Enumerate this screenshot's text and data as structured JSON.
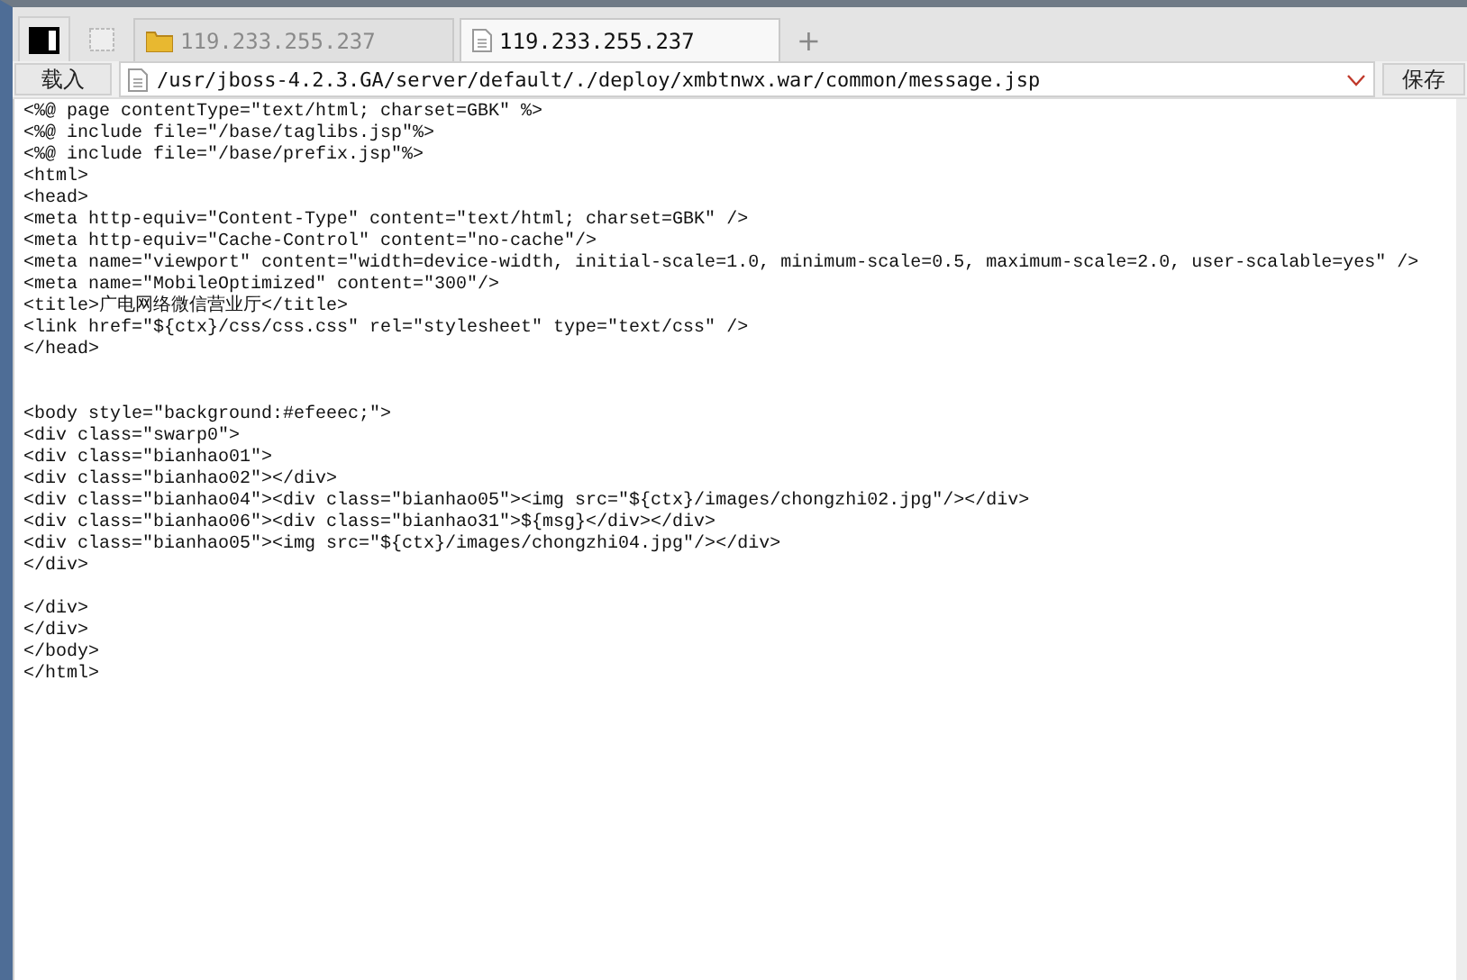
{
  "tabs": [
    {
      "label": "119.233.255.237",
      "kind": "folder",
      "selected": false
    },
    {
      "label": "119.233.255.237",
      "kind": "document",
      "selected": true
    }
  ],
  "new_tab": "+",
  "address_bar": {
    "load_button": "载入",
    "path": "/usr/jboss-4.2.3.GA/server/default/./deploy/xmbtnwx.war/common/message.jsp",
    "save_button": "保存"
  },
  "editor": {
    "lines": [
      {
        "kind": "line",
        "text": "<%@ page contentType=\"text/html; charset=GBK\" %>"
      },
      {
        "kind": "line",
        "text": "<%@ include file=\"/base/taglibs.jsp\"%>"
      },
      {
        "kind": "line",
        "text": "<%@ include file=\"/base/prefix.jsp\"%>"
      },
      {
        "kind": "line",
        "text": "<html>"
      },
      {
        "kind": "line",
        "text": "<head>"
      },
      {
        "kind": "line",
        "text": "<meta http-equiv=\"Content-Type\" content=\"text/html; charset=GBK\" />"
      },
      {
        "kind": "line",
        "text": "<meta http-equiv=\"Cache-Control\" content=\"no-cache\"/>"
      },
      {
        "kind": "line",
        "text": "<meta name=\"viewport\" content=\"width=device-width, initial-scale=1.0, minimum-scale=0.5, maximum-scale=2.0, user-scalable=yes\" />"
      },
      {
        "kind": "line",
        "text": "<meta name=\"MobileOptimized\" content=\"300\"/>"
      },
      {
        "kind": "line",
        "text": "<title>广电网络微信营业厅</title>"
      },
      {
        "kind": "line",
        "text": "<link href=\"${ctx}/css/css.css\" rel=\"stylesheet\" type=\"text/css\" />"
      },
      {
        "kind": "line",
        "text": "</head>"
      },
      {
        "kind": "blank"
      },
      {
        "kind": "blank"
      },
      {
        "kind": "line",
        "text": "<body style=\"background:#efeeec;\">"
      },
      {
        "kind": "line",
        "text": "<div class=\"swarp0\">"
      },
      {
        "kind": "line",
        "text": "<div class=\"bianhao01\">"
      },
      {
        "kind": "line",
        "text": "<div class=\"bianhao02\"></div>"
      },
      {
        "kind": "line",
        "text": "<div class=\"bianhao04\"><div class=\"bianhao05\"><img src=\"${ctx}/images/chongzhi02.jpg\"/></div>"
      },
      {
        "kind": "line",
        "text": "<div class=\"bianhao06\"><div class=\"bianhao31\">${msg}</div></div>"
      },
      {
        "kind": "line",
        "text": "<div class=\"bianhao05\"><img src=\"${ctx}/images/chongzhi04.jpg\"/></div>"
      },
      {
        "kind": "line",
        "text": "</div>"
      },
      {
        "kind": "blank"
      },
      {
        "kind": "line",
        "text": "</div>"
      },
      {
        "kind": "line",
        "text": "</div>"
      },
      {
        "kind": "line",
        "text": "</body>"
      },
      {
        "kind": "line",
        "text": "</html>"
      }
    ]
  }
}
